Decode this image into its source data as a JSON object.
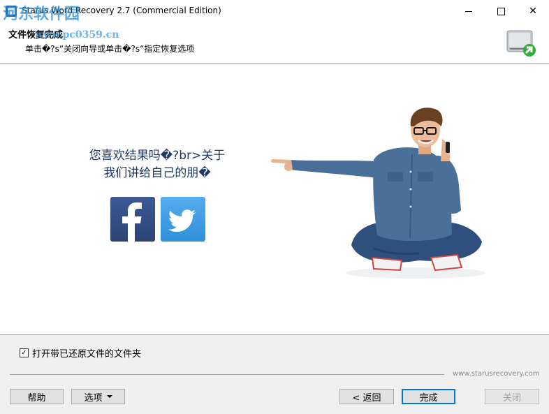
{
  "window": {
    "title": "Starus Word Recovery 2.7 (Commercial Edition)",
    "minimize_glyph": "",
    "close_glyph": "✕"
  },
  "watermark": {
    "text": "河东软件园",
    "url": "www.pc0359.cn"
  },
  "header": {
    "title": "文件恢复完成",
    "subtitle": "单击�?s“关闭向导或单击�?s“指定恢复选项"
  },
  "main": {
    "question_line1": "您喜欢结果吗�?br>关于",
    "question_line2": "我们讲给自己的朋�",
    "social": [
      {
        "name": "facebook",
        "icon": "facebook-icon",
        "color": "#3b5998",
        "glyph": "f"
      },
      {
        "name": "twitter",
        "icon": "twitter-icon",
        "color": "#55acee"
      }
    ]
  },
  "footer": {
    "checkbox_label": "打开带已还原文件的文件夹",
    "checkbox_checked": true,
    "site_url": "www.starusrecovery.com",
    "buttons": {
      "help": "帮助",
      "options": "选项",
      "back": "< 返回",
      "finish": "完成",
      "close": "关闭"
    }
  }
}
